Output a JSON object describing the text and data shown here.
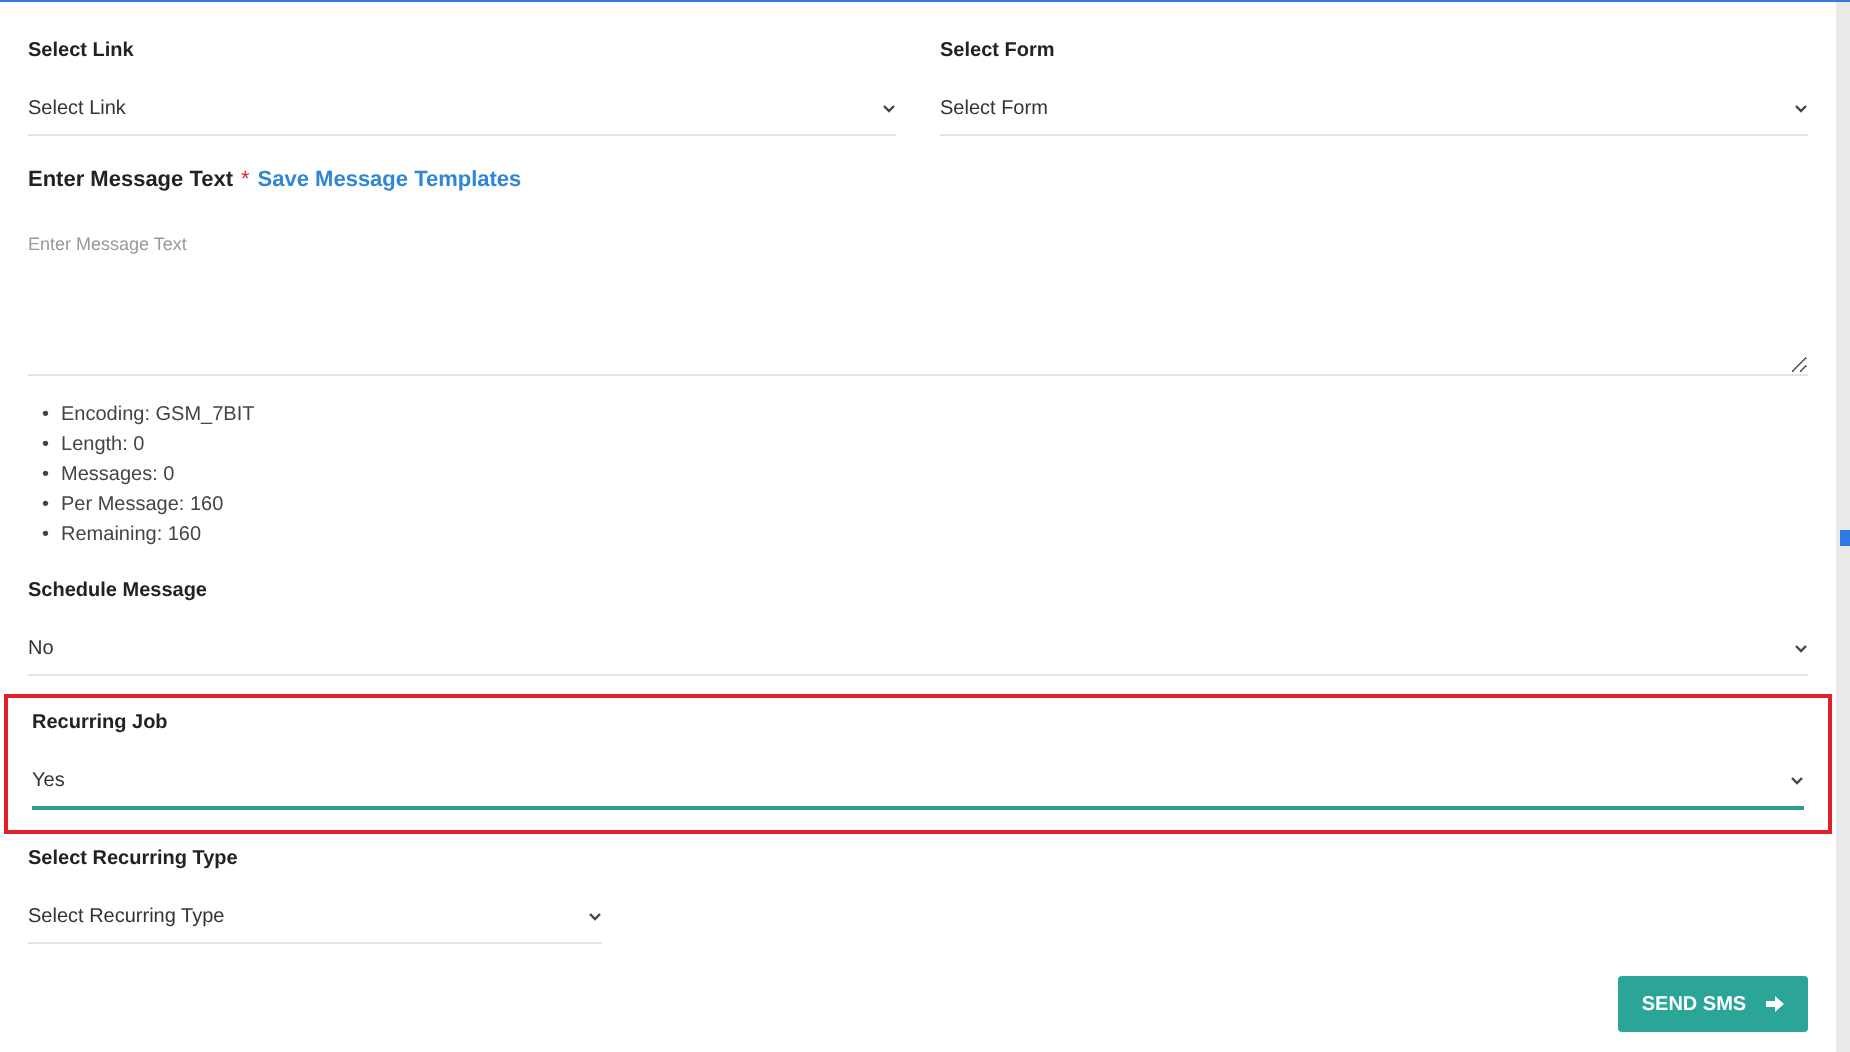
{
  "top_selects": [
    {
      "label": "Select Link",
      "value": "Select Link"
    },
    {
      "label": "Select Form",
      "value": "Select Form"
    }
  ],
  "message": {
    "label": "Enter Message Text",
    "required_mark": "*",
    "template_link": "Save Message Templates",
    "placeholder": "Enter Message Text"
  },
  "stats": [
    {
      "bullet": "•",
      "text": "Encoding: GSM_7BIT"
    },
    {
      "bullet": "•",
      "text": "Length: 0"
    },
    {
      "bullet": "•",
      "text": "Messages: 0"
    },
    {
      "bullet": "•",
      "text": "Per Message: 160"
    },
    {
      "bullet": "•",
      "text": "Remaining: 160"
    }
  ],
  "schedule": {
    "label": "Schedule Message",
    "value": "No",
    "focused": false
  },
  "recurring": {
    "label": "Recurring Job",
    "value": "Yes",
    "focused": true,
    "highlighted": true
  },
  "recurring_type": {
    "label": "Select Recurring Type",
    "value": "Select Recurring Type"
  },
  "send_button": "SEND SMS"
}
